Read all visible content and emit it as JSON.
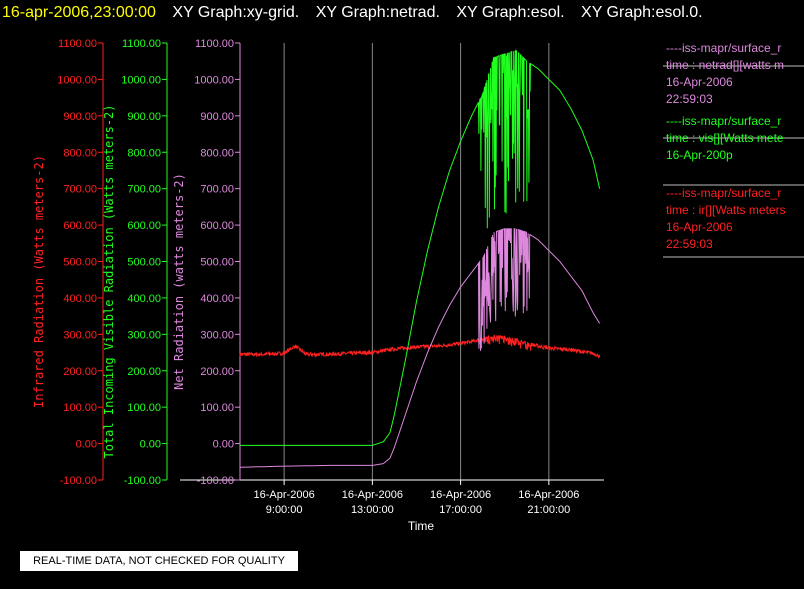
{
  "header": {
    "timestamp": "16-apr-2006,23:00:00",
    "graphs": [
      "XY Graph:xy-grid.",
      "XY Graph:netrad.",
      "XY Graph:esol.",
      "XY Graph:esol.0."
    ]
  },
  "colors": {
    "ir": "#ff2020",
    "vis": "#20ff20",
    "net": "#dd88dd",
    "timestamp": "#ffff00",
    "grid": "#888888"
  },
  "chart_data": {
    "type": "line",
    "xlabel": "Time",
    "x_ticks": [
      {
        "date": "16-Apr-2006",
        "time": "9:00:00",
        "hour": 9
      },
      {
        "date": "16-Apr-2006",
        "time": "13:00:00",
        "hour": 13
      },
      {
        "date": "16-Apr-2006",
        "time": "17:00:00",
        "hour": 17
      },
      {
        "date": "16-Apr-2006",
        "time": "21:00:00",
        "hour": 21
      }
    ],
    "xlim": [
      7.0,
      23.5
    ],
    "ylim": [
      -100,
      1100
    ],
    "y_ticks": [
      -100,
      0,
      100,
      200,
      300,
      400,
      500,
      600,
      700,
      800,
      900,
      1000,
      1100
    ],
    "y_tick_labels": [
      "-100.00",
      "0.00",
      "100.00",
      "200.00",
      "300.00",
      "400.00",
      "500.00",
      "600.00",
      "700.00",
      "800.00",
      "900.00",
      "1000.00",
      "1100.00"
    ],
    "grid": true,
    "axes": [
      {
        "id": "ir",
        "label": "Infrared Radiation (Watts meters-2)",
        "color": "#ff2020"
      },
      {
        "id": "vis",
        "label": "Total Incoming Visible Radiation (Watts meters-2)",
        "color": "#20ff20"
      },
      {
        "id": "net",
        "label": "Net Radiation (watts meters-2)",
        "color": "#dd88dd"
      }
    ],
    "series": [
      {
        "id": "vis",
        "color": "#20ff20",
        "x": [
          7.0,
          9.0,
          11.0,
          13.0,
          13.5,
          13.8,
          14.0,
          14.5,
          15.0,
          15.5,
          16.0,
          16.5,
          17.0,
          17.5,
          18.0,
          18.5,
          19.0,
          19.5,
          20.0,
          20.5,
          21.0,
          21.5,
          22.0,
          22.5,
          23.0,
          23.3
        ],
        "y": [
          -5,
          -5,
          -5,
          -5,
          5,
          30,
          80,
          230,
          390,
          530,
          650,
          750,
          830,
          900,
          960,
          1060,
          1070,
          1080,
          1050,
          1030,
          1000,
          970,
          920,
          860,
          780,
          700
        ]
      },
      {
        "id": "net",
        "color": "#dd88dd",
        "x": [
          7.0,
          9.0,
          11.0,
          13.0,
          13.5,
          13.8,
          14.0,
          14.5,
          15.0,
          15.5,
          16.0,
          16.5,
          17.0,
          17.5,
          18.0,
          18.5,
          19.0,
          19.5,
          20.0,
          20.5,
          21.0,
          21.5,
          22.0,
          22.5,
          23.0,
          23.3
        ],
        "y": [
          -65,
          -62,
          -60,
          -60,
          -55,
          -40,
          -10,
          80,
          170,
          250,
          320,
          380,
          430,
          470,
          510,
          580,
          590,
          590,
          580,
          560,
          530,
          500,
          460,
          420,
          360,
          330
        ]
      },
      {
        "id": "ir",
        "color": "#ff2020",
        "x": [
          7.0,
          8.0,
          9.0,
          9.5,
          10.0,
          11.0,
          12.0,
          13.0,
          14.0,
          15.0,
          16.0,
          17.0,
          17.5,
          18.0,
          18.5,
          19.0,
          19.5,
          20.0,
          20.5,
          21.0,
          22.0,
          22.5,
          23.0,
          23.3
        ],
        "y": [
          245,
          245,
          248,
          268,
          245,
          245,
          248,
          250,
          260,
          265,
          268,
          275,
          280,
          288,
          295,
          292,
          285,
          275,
          268,
          262,
          258,
          252,
          248,
          240
        ]
      }
    ]
  },
  "legend": [
    {
      "line1": "----iss-mapr/surface_r",
      "line2": "time : netrad[][watts m",
      "line3": "16-Apr-2006",
      "line4": "22:59:03",
      "color": "#dd88dd"
    },
    {
      "line1": "----iss-mapr/surface_r",
      "line2": "time : vis[][Watts mete",
      "line3": "16-Apr-200p",
      "line4": "",
      "color": "#20ff20"
    },
    {
      "line1": "----iss-mapr/surface_r",
      "line2": "time : ir[][Watts meters",
      "line3": "16-Apr-2006",
      "line4": "22:59:03",
      "color": "#ff2020"
    }
  ],
  "note": "REAL-TIME DATA, NOT CHECKED FOR QUALITY"
}
